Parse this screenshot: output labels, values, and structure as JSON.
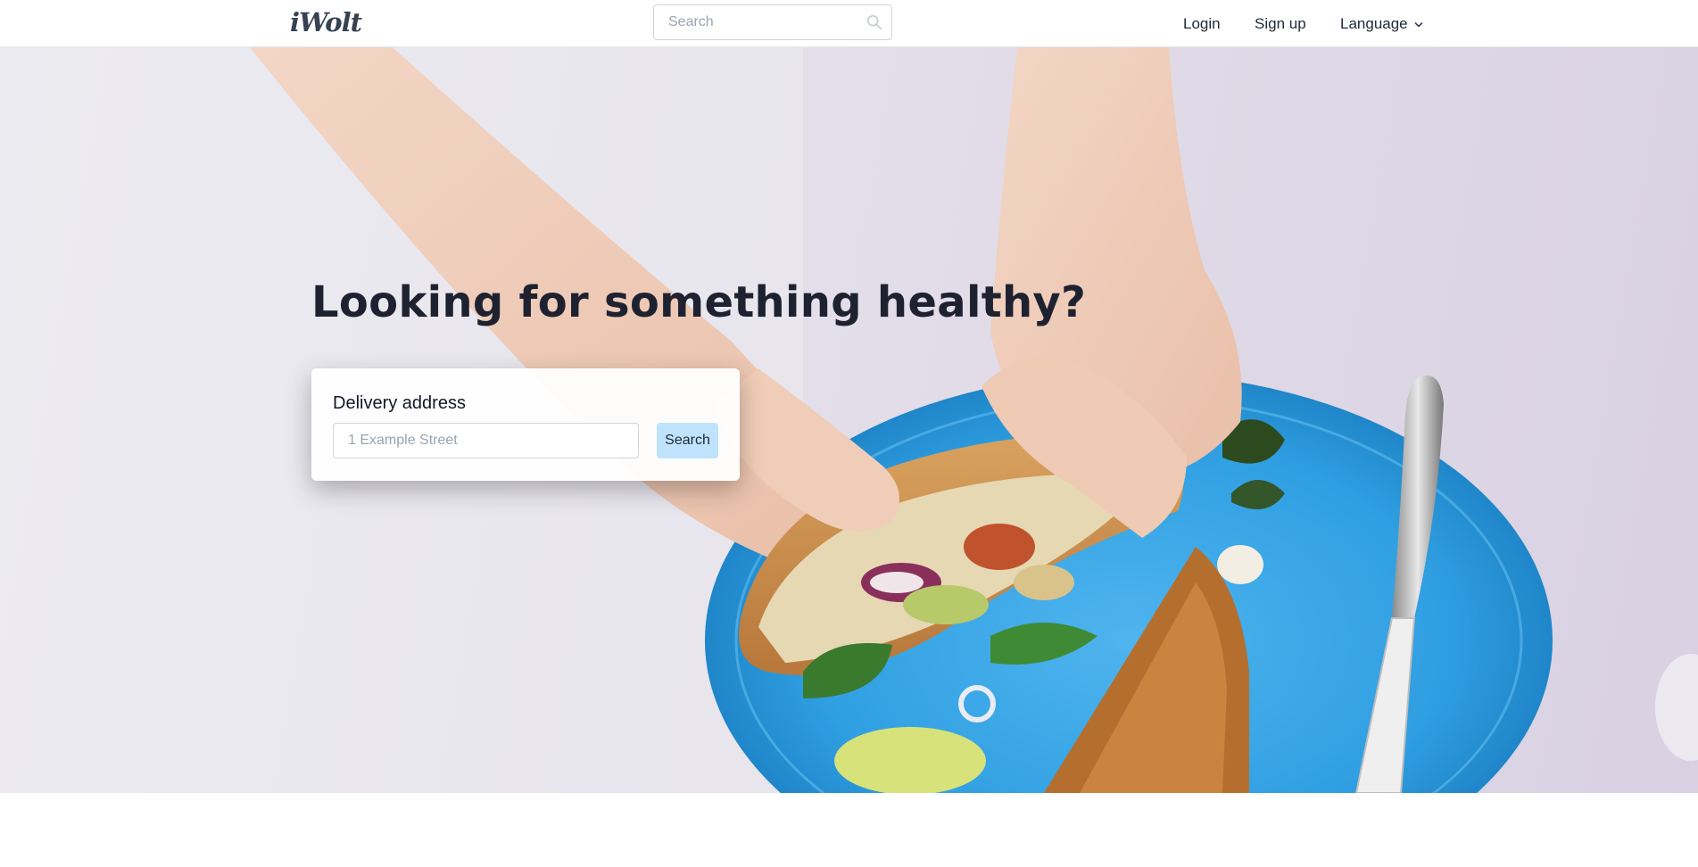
{
  "header": {
    "logo_text": "iWolt",
    "search_placeholder": "Search",
    "login_label": "Login",
    "signup_label": "Sign up",
    "language_label": "Language"
  },
  "hero": {
    "headline": "Looking for something healthy?",
    "address_card": {
      "label": "Delivery address",
      "input_placeholder": "1 Example Street",
      "search_button_label": "Search"
    }
  },
  "colors": {
    "hero_background": "#e3dfea",
    "plate_blue": "#35a6e6",
    "search_button": "#bfe3fb",
    "headline_text": "#1e2230"
  },
  "icons": {
    "top_search": "search-icon",
    "language_dropdown": "chevron-down-icon"
  }
}
